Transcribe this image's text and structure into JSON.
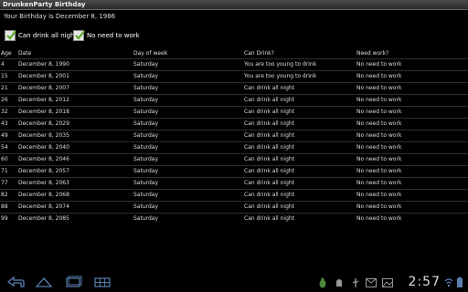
{
  "app": {
    "title": "DrunkenParty Birthday"
  },
  "birthday_text": "Your Birthday is December 8, 1986",
  "checkboxes": [
    {
      "label": "Can drink all night",
      "checked": true
    },
    {
      "label": "No need to work",
      "checked": true
    }
  ],
  "table": {
    "headers": [
      "Age",
      "Date",
      "Day of week",
      "Can Drink?",
      "Need work?"
    ],
    "rows": [
      [
        "4",
        "December 8, 1990",
        "Saturday",
        "You are too young to drink",
        "No need to work"
      ],
      [
        "15",
        "December 8, 2001",
        "Saturday",
        "You are too young to drink",
        "No need to work"
      ],
      [
        "21",
        "December 8, 2007",
        "Saturday",
        "Can drink all night",
        "No need to work"
      ],
      [
        "26",
        "December 8, 2012",
        "Saturday",
        "Can drink all night",
        "No need to work"
      ],
      [
        "32",
        "December 8, 2018",
        "Saturday",
        "Can drink all night",
        "No need to work"
      ],
      [
        "43",
        "December 8, 2029",
        "Saturday",
        "Can drink all night",
        "No need to work"
      ],
      [
        "49",
        "December 8, 2035",
        "Saturday",
        "Can drink all night",
        "No need to work"
      ],
      [
        "54",
        "December 8, 2040",
        "Saturday",
        "Can drink all night",
        "No need to work"
      ],
      [
        "60",
        "December 8, 2046",
        "Saturday",
        "Can drink all night",
        "No need to work"
      ],
      [
        "71",
        "December 8, 2057",
        "Saturday",
        "Can drink all night",
        "No need to work"
      ],
      [
        "77",
        "December 8, 2063",
        "Saturday",
        "Can drink all night",
        "No need to work"
      ],
      [
        "82",
        "December 8, 2068",
        "Saturday",
        "Can drink all night",
        "No need to work"
      ],
      [
        "88",
        "December 8, 2074",
        "Saturday",
        "Can drink all night",
        "No need to work"
      ],
      [
        "99",
        "December 8, 2085",
        "Saturday",
        "Can drink all night",
        "No need to work"
      ]
    ]
  },
  "status_bar": {
    "time": "2:57"
  },
  "icons": {
    "nav": [
      "back-icon",
      "home-icon",
      "recent-apps-icon"
    ],
    "status": [
      "bug-icon",
      "android-icon",
      "usb-icon",
      "gmail-icon",
      "image-icon",
      "wifi-icon",
      "battery-icon"
    ]
  },
  "colors": {
    "accent_check": "#5aa82d",
    "background": "#000000",
    "titlebar": "#3a3a3a"
  }
}
